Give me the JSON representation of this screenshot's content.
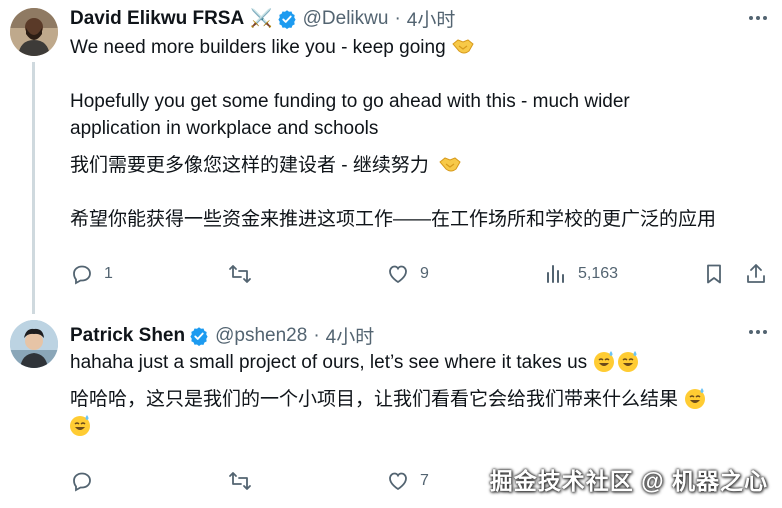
{
  "tweet1": {
    "name": "David Elikwu FRSA",
    "name_emoji": "⚔️",
    "handle": "@Delikwu",
    "separator": "·",
    "time": "4小时",
    "line1": "We need more builders like you - keep going",
    "line2": "Hopefully you get some funding to go ahead with this - much wider",
    "line3": "application in workplace and schools",
    "line4": "我们需要更多像您这样的建设者 - 继续努力",
    "line5": "希望你能获得一些资金来推进这项工作——在工作场所和学校的更广泛的应用",
    "replies": "1",
    "retweets": "",
    "likes": "9",
    "views": "5,163"
  },
  "tweet2": {
    "name": "Patrick Shen",
    "handle": "@pshen28",
    "separator": "·",
    "time": "4小时",
    "line1": "hahaha just a small project of ours, let’s see where it takes us",
    "line2": "哈哈哈，这只是我们的一个小项目，让我们看看它会给我们带来什么结果",
    "replies": "",
    "retweets": "",
    "likes": "7"
  },
  "watermark": "掘金技术社区 @ 机器之心",
  "colors": {
    "text": "#0f1419",
    "secondary": "#536471",
    "verified": "#1d9bf0",
    "thread_line": "#cfd9de"
  },
  "icons": [
    "more-icon",
    "verified-icon",
    "reply-icon",
    "retweet-icon",
    "like-icon",
    "views-icon",
    "bookmark-icon",
    "share-icon",
    "handshake-emoji",
    "sweat-smile-emoji"
  ]
}
